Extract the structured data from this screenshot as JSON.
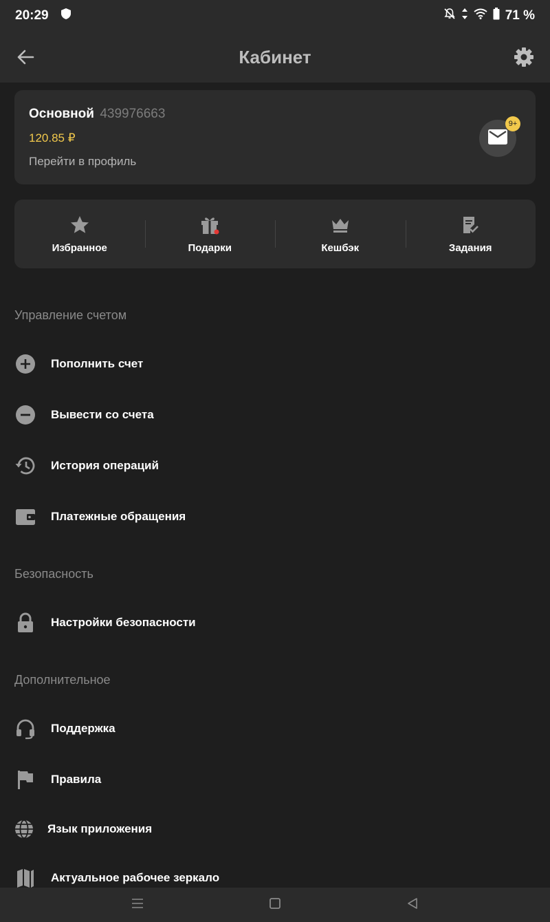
{
  "status_bar": {
    "time": "20:29",
    "battery": "71 %"
  },
  "app_bar": {
    "title": "Кабинет"
  },
  "profile": {
    "name": "Основной",
    "account_number": "439976663",
    "balance": "120.85 ₽",
    "profile_link": "Перейти в профиль",
    "mail_badge": "9+"
  },
  "quick_actions": [
    {
      "label": "Избранное",
      "icon": "star-icon"
    },
    {
      "label": "Подарки",
      "icon": "gift-icon"
    },
    {
      "label": "Кешбэк",
      "icon": "crown-icon"
    },
    {
      "label": "Задания",
      "icon": "tasks-icon"
    }
  ],
  "sections": {
    "account": {
      "title": "Управление счетом",
      "items": [
        {
          "label": "Пополнить счет",
          "icon": "plus-circle-icon"
        },
        {
          "label": "Вывести со счета",
          "icon": "minus-circle-icon"
        },
        {
          "label": "История операций",
          "icon": "history-icon"
        },
        {
          "label": "Платежные обращения",
          "icon": "wallet-icon"
        }
      ]
    },
    "security": {
      "title": "Безопасность",
      "items": [
        {
          "label": "Настройки безопасности",
          "icon": "lock-icon"
        }
      ]
    },
    "additional": {
      "title": "Дополнительное",
      "items": [
        {
          "label": "Поддержка",
          "icon": "headset-icon"
        },
        {
          "label": "Правила",
          "icon": "flag-icon"
        },
        {
          "label": "Язык приложения",
          "icon": "globe-icon"
        },
        {
          "label": "Актуальное рабочее зеркало",
          "icon": "mirror-icon"
        }
      ]
    }
  },
  "colors": {
    "background": "#1e1e1e",
    "card": "#2c2c2c",
    "accent": "#f2c94c",
    "notification_dot": "#e53935"
  }
}
